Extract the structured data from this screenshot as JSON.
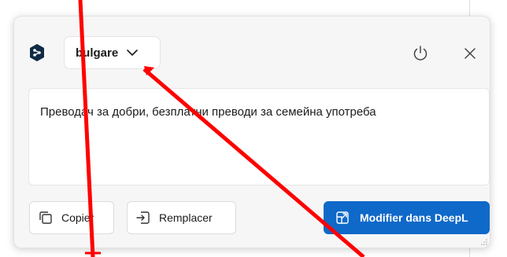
{
  "header": {
    "language_selected": "bulgare"
  },
  "editor": {
    "text": "Преводач за добри, безплатни преводи за семейна употреба"
  },
  "actions": {
    "copy_label": "Copier",
    "replace_label": "Remplacer",
    "edit_in_deepl_label": "Modifier dans DeepL"
  },
  "colors": {
    "primary": "#0f69c9",
    "logo": "#0f2b46",
    "annotation": "#ff0000"
  },
  "icons": {
    "logo": "deepl-logo-icon",
    "language_dropdown": "chevron-down-icon",
    "power": "power-icon",
    "close": "close-icon",
    "copy": "copy-icon",
    "replace": "replace-icon",
    "edit": "external-edit-icon"
  }
}
